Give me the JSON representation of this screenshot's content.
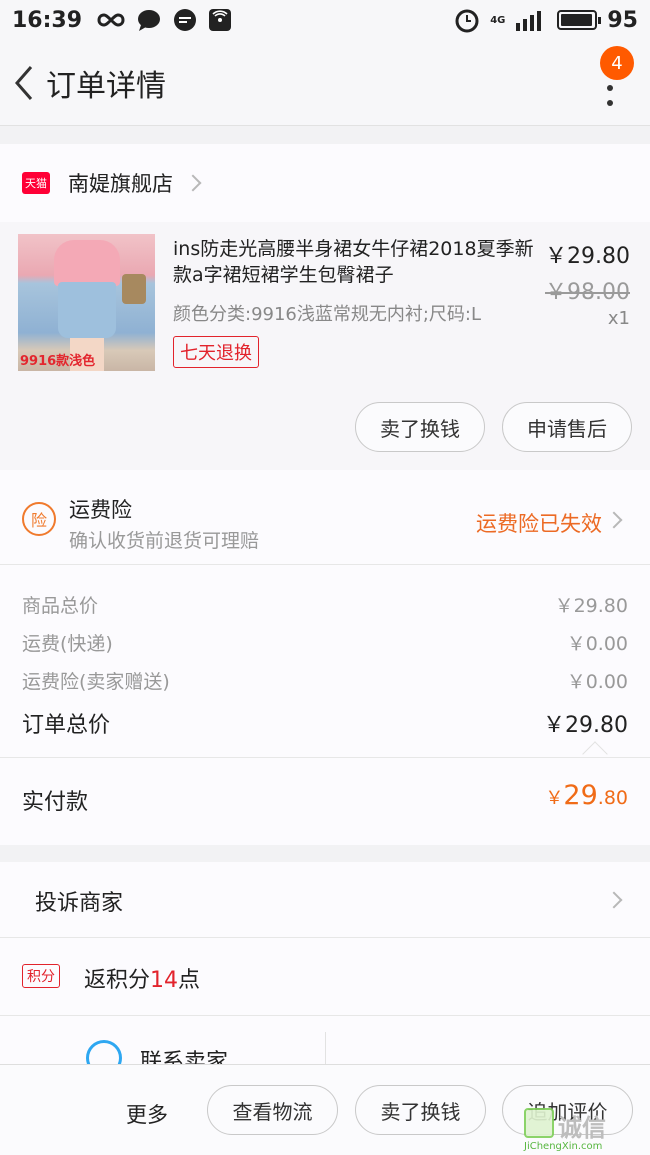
{
  "status_bar": {
    "time": "16:39",
    "network": "4G",
    "battery": "95",
    "battery_level": 0.95
  },
  "nav": {
    "title": "订单详情",
    "badge_count": "4"
  },
  "shop": {
    "logo_text": "天猫",
    "name": "南媞旗舰店"
  },
  "item": {
    "title": "ins防走光高腰半身裙女牛仔裙2018夏季新款a字裙短裙学生包臀裙子",
    "spec": "颜色分类:9916浅蓝常规无内衬;尺码:L",
    "badge": "七天退换",
    "image_tag": "9916款浅色",
    "price": "￥29.80",
    "original_price": "￥98.00",
    "quantity": "x1",
    "actions": [
      "卖了换钱",
      "申请售后"
    ]
  },
  "insurance": {
    "icon_text": "险",
    "title": "运费险",
    "subtitle": "确认收货前退货可理赔",
    "status": "运费险已失效"
  },
  "fees": [
    {
      "label": "商品总价",
      "value": "￥29.80"
    },
    {
      "label": "运费(快递)",
      "value": "￥0.00"
    },
    {
      "label": "运费险(卖家赠送)",
      "value": "￥0.00"
    },
    {
      "label": "订单总价",
      "value": "￥29.80"
    }
  ],
  "paid": {
    "label": "实付款",
    "symbol": "￥",
    "integer": "29",
    "decimal": ".80"
  },
  "complain": {
    "label": "投诉商家"
  },
  "points": {
    "tag": "积分",
    "prefix": "返积分",
    "num": "14",
    "suffix": "点"
  },
  "contact": {
    "label": "联系卖家"
  },
  "bottom_bar": {
    "more": "更多",
    "buttons": [
      "查看物流",
      "卖了换钱",
      "追加评价"
    ]
  },
  "watermark": {
    "text": "诚信",
    "url": "JiChengXin.com"
  },
  "colors": {
    "accent_orange": "#ec6a24",
    "tmall_red": "#ff0036",
    "badge_orange": "#ff5a00",
    "link_blue": "#2ea7f1"
  }
}
